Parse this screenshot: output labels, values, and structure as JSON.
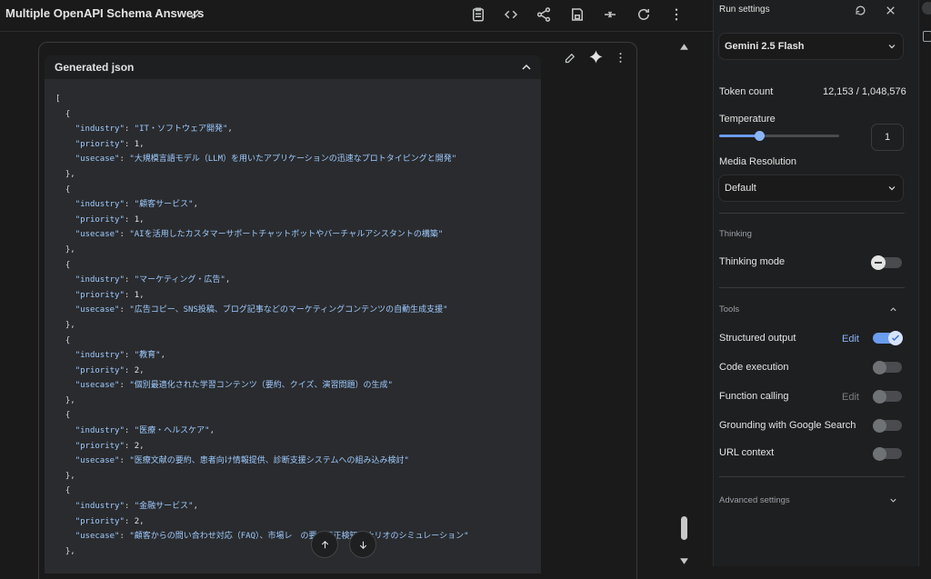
{
  "header": {
    "title": "Multiple OpenAPI Schema Answers"
  },
  "json_panel": {
    "title": "Generated json",
    "entries": [
      {
        "industry": "IT・ソフトウェア開発",
        "priority": "1",
        "usecase": "大規模言語モデル（LLM）を用いたアプリケーションの迅速なプロトタイピングと開発"
      },
      {
        "industry": "顧客サービス",
        "priority": "1",
        "usecase": "AIを活用したカスタマーサポートチャットボットやバーチャルアシスタントの構築"
      },
      {
        "industry": "マーケティング・広告",
        "priority": "1",
        "usecase": "広告コピー、SNS投稿、ブログ記事などのマーケティングコンテンツの自動生成支援"
      },
      {
        "industry": "教育",
        "priority": "2",
        "usecase": "個別最適化された学習コンテンツ（要約、クイズ、演習問題）の生成"
      },
      {
        "industry": "医療・ヘルスケア",
        "priority": "2",
        "usecase": "医療文献の要約、患者向け情報提供、診断支援システムへの組み込み検討"
      },
      {
        "industry": "金融サービス",
        "priority": "2",
        "usecase": "顧客からの問い合わせ対応（FAQ）、市場レ　の要　不正検知シナリオのシミュレーション"
      }
    ]
  },
  "run_settings": {
    "title": "Run settings",
    "model": "Gemini 2.5 Flash",
    "token_count_label": "Token count",
    "token_count_value": "12,153 / 1,048,576",
    "temperature_label": "Temperature",
    "temperature_value": "1",
    "temperature_fraction": 0.33,
    "media_resolution_label": "Media Resolution",
    "media_resolution_value": "Default",
    "thinking_section": "Thinking",
    "thinking_mode_label": "Thinking mode",
    "tools_section": "Tools",
    "structured_output_label": "Structured output",
    "structured_output_edit": "Edit",
    "code_execution_label": "Code execution",
    "function_calling_label": "Function calling",
    "function_calling_edit": "Edit",
    "grounding_label": "Grounding with Google Search",
    "url_context_label": "URL context",
    "advanced_settings_label": "Advanced settings"
  },
  "colors": {
    "accent": "#8ab4f8",
    "toggle_on": "#6a9cf0"
  }
}
